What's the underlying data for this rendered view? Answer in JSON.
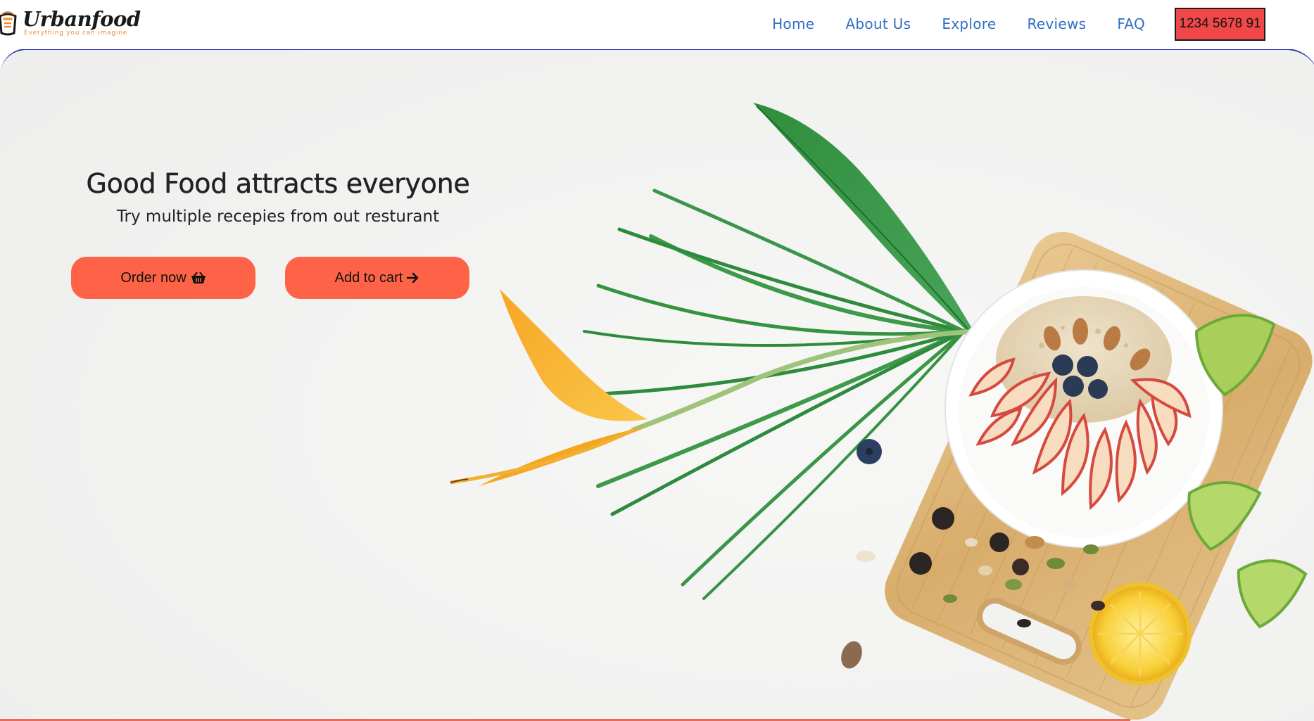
{
  "brand": {
    "name": "Urbanfood",
    "tagline": "Everything you can imagine"
  },
  "nav": {
    "links": [
      "Home",
      "About Us",
      "Explore",
      "Reviews",
      "FAQ"
    ],
    "phone": "1234 5678 91"
  },
  "hero": {
    "title": "Good Food attracts everyone",
    "subtitle": "Try multiple recepies from out resturant",
    "buttons": {
      "order_label": "Order now",
      "order_icon": "basket-icon",
      "cart_label": "Add to cart",
      "cart_icon": "arrow-right-icon"
    },
    "image": "food-bowl-illustration"
  },
  "colors": {
    "accent": "#fe6347",
    "nav_link": "#2f6fc4",
    "phone_bg": "#f04848",
    "hero_border": "#1f2bb0"
  }
}
